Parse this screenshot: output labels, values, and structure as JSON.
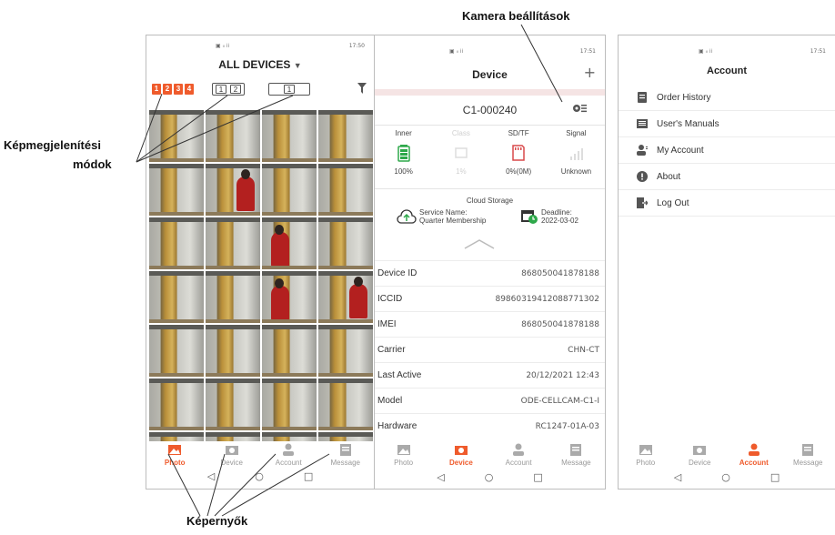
{
  "annotations": {
    "camera_settings": "Kamera beállítások",
    "display_modes_line1": "Képmegjelenítési",
    "display_modes_line2": "módok",
    "screens": "Képernyők"
  },
  "phone1": {
    "status_time": "17:50",
    "title": "ALL DEVICES",
    "caret": "▼",
    "mode_grid4": [
      "1",
      "2",
      "3",
      "4"
    ],
    "mode_grid2": [
      "1",
      "2"
    ],
    "mode_grid1": [
      "1"
    ]
  },
  "phone2": {
    "status_time": "17:51",
    "title": "Device",
    "plus": "+",
    "camera_name": "C1-000240",
    "stats": [
      {
        "label": "Inner",
        "value": "100%"
      },
      {
        "label": "Class",
        "value": "1%"
      },
      {
        "label": "SD/TF",
        "value": "0%(0M)"
      },
      {
        "label": "Signal",
        "value": "Unknown"
      }
    ],
    "cloud_title": "Cloud Storage",
    "service_label": "Service Name:",
    "service_value": "Quarter Membership",
    "deadline_label": "Deadline:",
    "deadline_value": "2022-03-02",
    "info": [
      {
        "label": "Device ID",
        "value": "868050041878188"
      },
      {
        "label": "ICCID",
        "value": "89860319412088771302"
      },
      {
        "label": "IMEI",
        "value": "868050041878188"
      },
      {
        "label": "Carrier",
        "value": "CHN-CT"
      },
      {
        "label": "Last Active",
        "value": "20/12/2021 12:43"
      },
      {
        "label": "Model",
        "value": "ODE-CELLCAM-C1-I"
      },
      {
        "label": "Hardware",
        "value": "RC1247-01A-03"
      }
    ]
  },
  "phone3": {
    "status_time": "17:51",
    "title": "Account",
    "menu": [
      {
        "label": "Order History",
        "icon": "order-icon"
      },
      {
        "label": "User's Manuals",
        "icon": "manual-icon"
      },
      {
        "label": "My Account",
        "icon": "user-icon"
      },
      {
        "label": "About",
        "icon": "info-icon"
      },
      {
        "label": "Log Out",
        "icon": "logout-icon"
      }
    ]
  },
  "tabs": {
    "photo": "Photo",
    "device": "Device",
    "account": "Account",
    "message": "Message"
  },
  "nav": {
    "back": "◁",
    "home": "○",
    "recent": "□"
  },
  "colors": {
    "accent": "#ef5b2c",
    "green": "#2ea84a",
    "inactive": "#999999"
  }
}
